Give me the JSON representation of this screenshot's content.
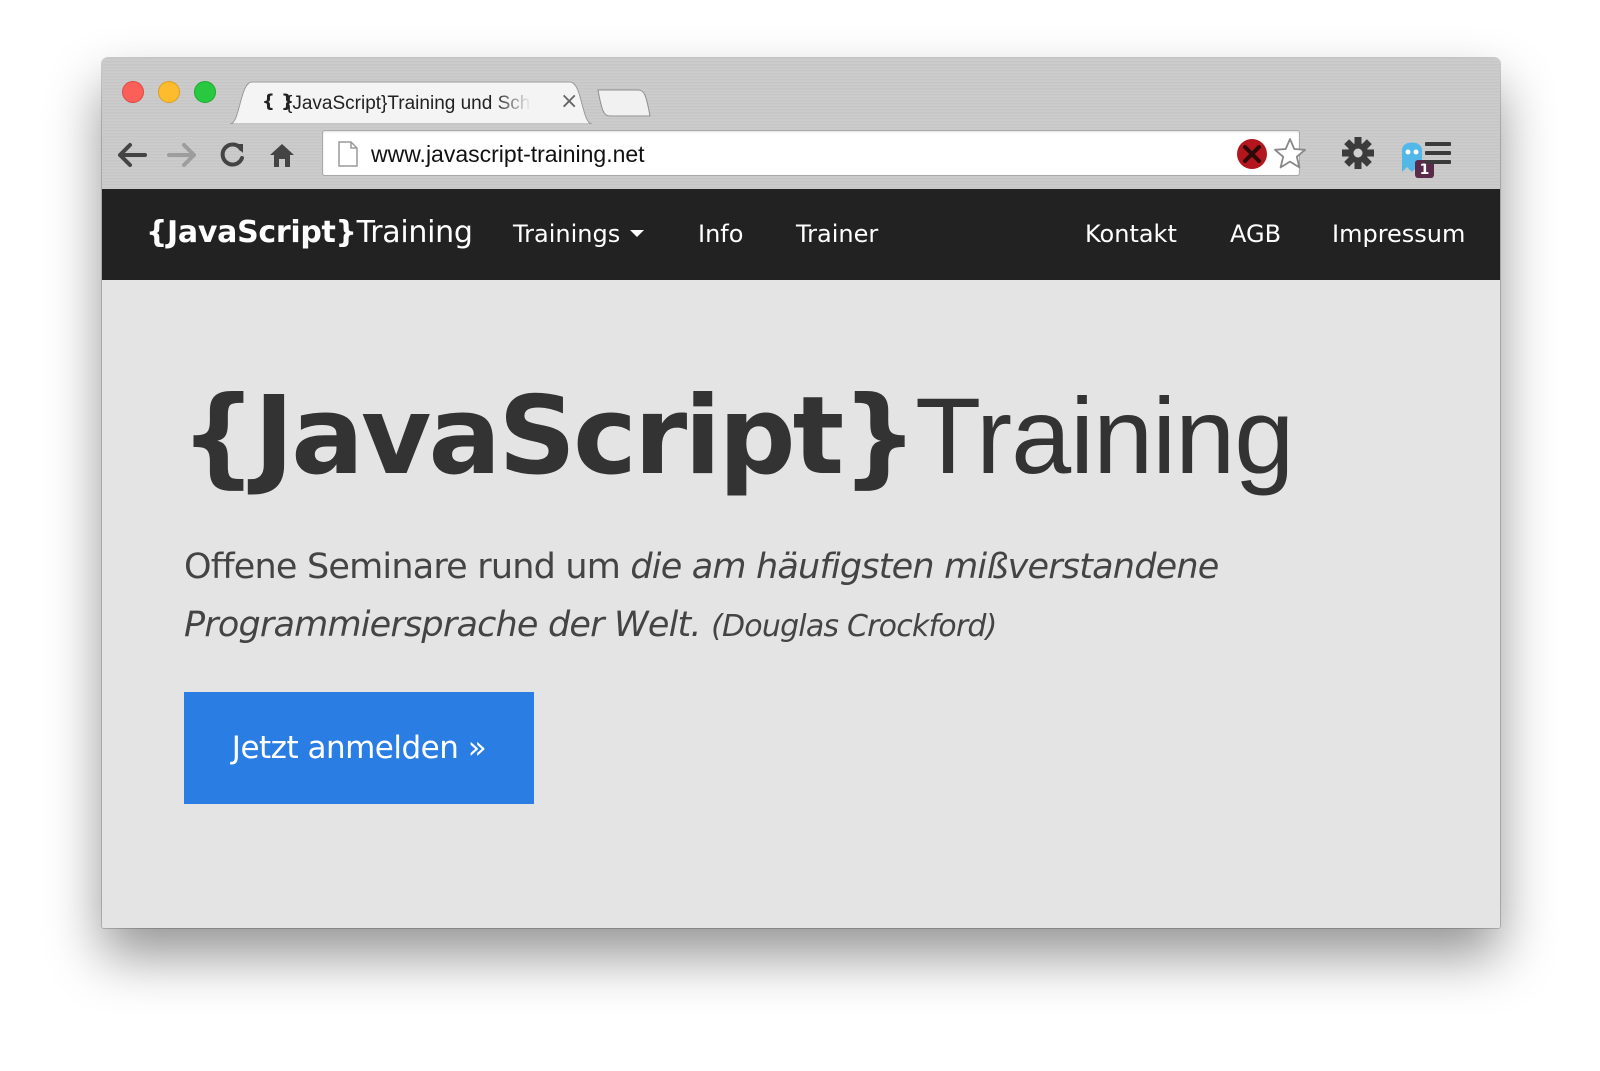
{
  "browser": {
    "tab": {
      "icon_text": "{ }",
      "title": "{JavaScript}Training und Schulungen",
      "close_glyph": "×"
    },
    "address_bar": {
      "url": "www.javascript-training.net"
    },
    "toolbar_icons": [
      "back-icon",
      "forward-icon",
      "reload-icon",
      "home-icon",
      "page-icon",
      "blocked-icon",
      "star-icon",
      "gear-icon",
      "ghostery-icon",
      "menu-icon"
    ],
    "extension_badge": "1",
    "colors": {
      "close": "#fc5f57",
      "minimize": "#fdbc2e",
      "maximize": "#28c840"
    }
  },
  "navbar": {
    "brand_bold": "{JavaScript}",
    "brand_light": "Training",
    "left_items": [
      "Trainings",
      "Info",
      "Trainer"
    ],
    "right_items": [
      "Kontakt",
      "AGB",
      "Impressum"
    ],
    "background": "#222222"
  },
  "hero": {
    "title_bold": "{JavaScript}",
    "title_light": "Training",
    "lead_plain": "Offene Seminare rund um ",
    "lead_italic": "die am häufigsten mißverstandene Programmiersprache der Welt.",
    "lead_attribution": "(Douglas Crockford)",
    "cta_label": "Jetzt anmelden »",
    "cta_color": "#2a7ee3",
    "background": "#e4e4e4"
  }
}
